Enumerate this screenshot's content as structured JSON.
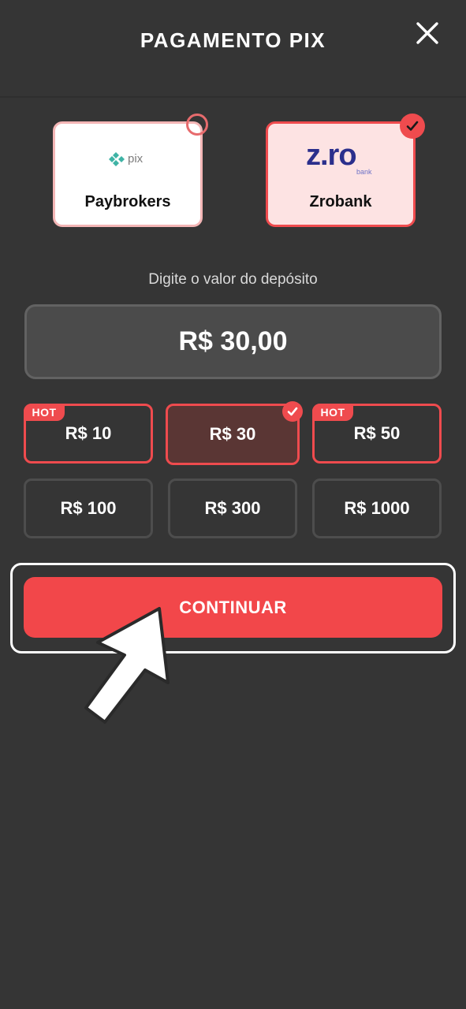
{
  "header": {
    "title": "PAGAMENTO PIX",
    "close_icon": "close-icon"
  },
  "providers": [
    {
      "name": "Paybrokers",
      "logo_text": "pix",
      "selected": false
    },
    {
      "name": "Zrobank",
      "logo_text": "z.ro",
      "logo_subtext": "bank",
      "selected": true
    }
  ],
  "deposit": {
    "prompt": "Digite o valor do depósito",
    "value": "R$ 30,00"
  },
  "amount_options": [
    {
      "label": "R$ 10",
      "hot": true,
      "selected": false
    },
    {
      "label": "R$ 30",
      "hot": false,
      "selected": true
    },
    {
      "label": "R$ 50",
      "hot": true,
      "selected": false
    },
    {
      "label": "R$ 100",
      "hot": false,
      "selected": false
    },
    {
      "label": "R$ 300",
      "hot": false,
      "selected": false
    },
    {
      "label": "R$ 1000",
      "hot": false,
      "selected": false
    }
  ],
  "hot_badge_label": "HOT",
  "continue_label": "CONTINUAR",
  "colors": {
    "background": "#353535",
    "accent": "#ef4b4e",
    "zrobank_brand": "#2b2f8c",
    "pix_brand": "#3fb3a5"
  }
}
